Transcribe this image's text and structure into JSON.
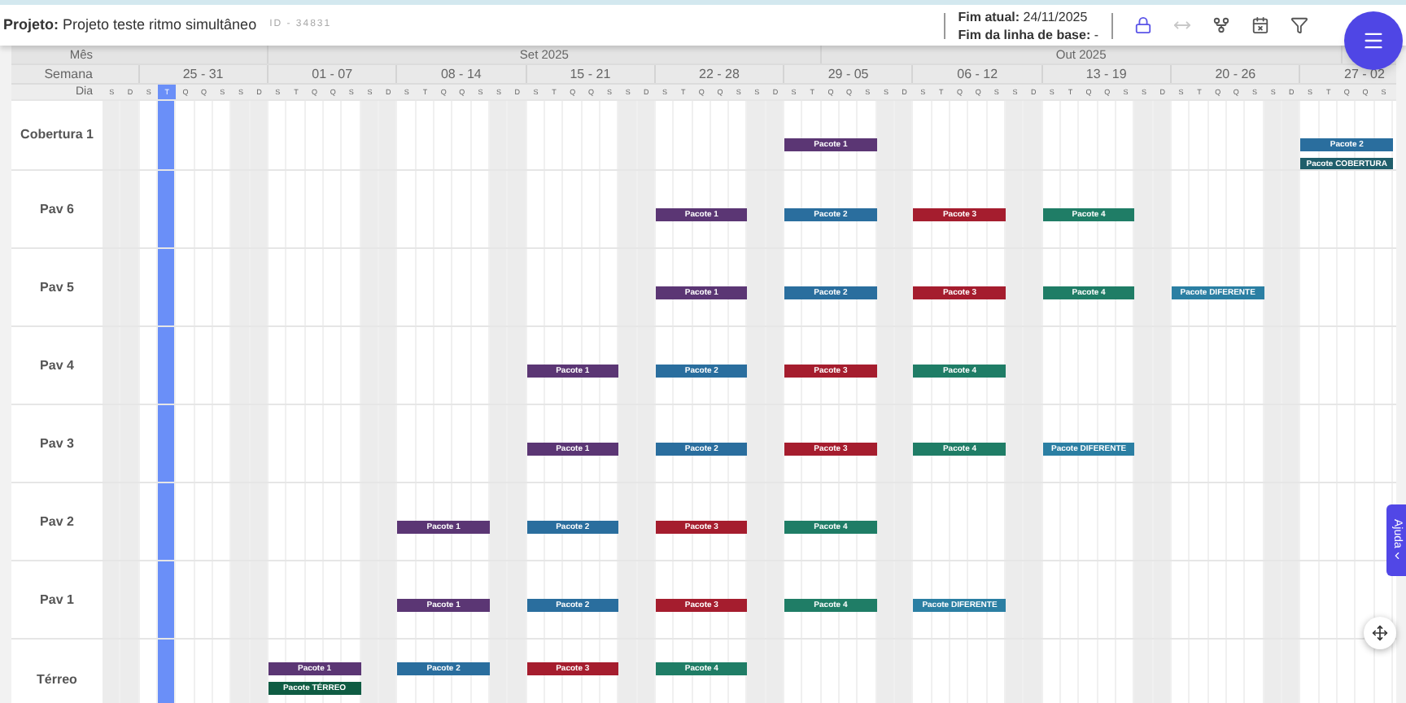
{
  "header": {
    "project": "**Projeto:** Projeto teste ritmo simultâneo",
    "project_id": "ID - 34831",
    "current_end": "**Fim atual:** 24/11/2025",
    "baseline_end": "**Fim da linha de base:** -",
    "toolbar": [
      {
        "kind": "lock",
        "disabled": false
      },
      {
        "kind": "expand",
        "disabled": true
      },
      {
        "kind": "fork",
        "disabled": false
      },
      {
        "kind": "calendar",
        "disabled": false
      },
      {
        "kind": "filter",
        "disabled": false
      }
    ]
  },
  "grid": {
    "month_label": "Mês",
    "week_label": "Semana",
    "day_label": "Dia",
    "months": [
      "Set 2025",
      "Out 2025"
    ],
    "weeks": [
      "25 - 31",
      "01 - 07",
      "08 - 14",
      "15 - 21",
      "22 - 28",
      "29 - 05",
      "06 - 12",
      "13 - 19",
      "20 - 26",
      "27 - 02"
    ],
    "days": [
      {
        "letter": "S",
        "today": false
      },
      {
        "letter": "D",
        "today": false
      },
      {
        "letter": "S",
        "today": false
      },
      {
        "letter": "T",
        "today": true
      },
      {
        "letter": "Q",
        "today": false
      },
      {
        "letter": "Q",
        "today": false
      },
      {
        "letter": "S",
        "today": false
      },
      {
        "letter": "S",
        "today": false
      },
      {
        "letter": "D",
        "today": false
      },
      {
        "letter": "S",
        "today": false
      },
      {
        "letter": "T",
        "today": false
      },
      {
        "letter": "Q",
        "today": false
      },
      {
        "letter": "Q",
        "today": false
      },
      {
        "letter": "S",
        "today": false
      },
      {
        "letter": "S",
        "today": false
      },
      {
        "letter": "D",
        "today": false
      },
      {
        "letter": "S",
        "today": false
      },
      {
        "letter": "T",
        "today": false
      },
      {
        "letter": "Q",
        "today": false
      },
      {
        "letter": "Q",
        "today": false
      },
      {
        "letter": "S",
        "today": false
      },
      {
        "letter": "S",
        "today": false
      },
      {
        "letter": "D",
        "today": false
      },
      {
        "letter": "S",
        "today": false
      },
      {
        "letter": "T",
        "today": false
      },
      {
        "letter": "Q",
        "today": false
      },
      {
        "letter": "Q",
        "today": false
      },
      {
        "letter": "S",
        "today": false
      },
      {
        "letter": "S",
        "today": false
      },
      {
        "letter": "D",
        "today": false
      },
      {
        "letter": "S",
        "today": false
      },
      {
        "letter": "T",
        "today": false
      },
      {
        "letter": "Q",
        "today": false
      },
      {
        "letter": "Q",
        "today": false
      },
      {
        "letter": "S",
        "today": false
      },
      {
        "letter": "S",
        "today": false
      },
      {
        "letter": "D",
        "today": false
      },
      {
        "letter": "S",
        "today": false
      },
      {
        "letter": "T",
        "today": false
      },
      {
        "letter": "Q",
        "today": false
      },
      {
        "letter": "Q",
        "today": false
      },
      {
        "letter": "S",
        "today": false
      },
      {
        "letter": "S",
        "today": false
      },
      {
        "letter": "D",
        "today": false
      },
      {
        "letter": "S",
        "today": false
      },
      {
        "letter": "T",
        "today": false
      },
      {
        "letter": "Q",
        "today": false
      },
      {
        "letter": "Q",
        "today": false
      },
      {
        "letter": "S",
        "today": false
      },
      {
        "letter": "S",
        "today": false
      },
      {
        "letter": "D",
        "today": false
      },
      {
        "letter": "S",
        "today": false
      },
      {
        "letter": "T",
        "today": false
      },
      {
        "letter": "Q",
        "today": false
      },
      {
        "letter": "Q",
        "today": false
      },
      {
        "letter": "S",
        "today": false
      },
      {
        "letter": "S",
        "today": false
      },
      {
        "letter": "D",
        "today": false
      },
      {
        "letter": "S",
        "today": false
      },
      {
        "letter": "T",
        "today": false
      },
      {
        "letter": "Q",
        "today": false
      },
      {
        "letter": "Q",
        "today": false
      },
      {
        "letter": "S",
        "today": false
      },
      {
        "letter": "S",
        "today": false
      },
      {
        "letter": "D",
        "today": false
      },
      {
        "letter": "S",
        "today": false
      },
      {
        "letter": "T",
        "today": false
      },
      {
        "letter": "Q",
        "today": false
      },
      {
        "letter": "Q",
        "today": false
      },
      {
        "letter": "S",
        "today": false
      }
    ],
    "rows": [
      {
        "label": "Cobertura 1",
        "weeks": {
          "week_5": [
            {
              "label": "Pacote 1",
              "color": "#5b3674"
            }
          ],
          "week_9": [
            {
              "label": "Pacote 2",
              "color": "#2a6e9e"
            },
            {
              "label": "Pacote COBERTURA",
              "color": "#1f5e6b"
            }
          ]
        }
      },
      {
        "label": "Pav 6",
        "weeks": {
          "week_4": [
            {
              "label": "Pacote 1",
              "color": "#5b3674"
            }
          ],
          "week_5": [
            {
              "label": "Pacote 2",
              "color": "#2a6e9e"
            }
          ],
          "week_6": [
            {
              "label": "Pacote 3",
              "color": "#a51d2e"
            }
          ],
          "week_7": [
            {
              "label": "Pacote 4",
              "color": "#1f7d66"
            }
          ]
        }
      },
      {
        "label": "Pav 5",
        "weeks": {
          "week_4": [
            {
              "label": "Pacote 1",
              "color": "#5b3674"
            }
          ],
          "week_5": [
            {
              "label": "Pacote 2",
              "color": "#2a6e9e"
            }
          ],
          "week_6": [
            {
              "label": "Pacote 3",
              "color": "#a51d2e"
            }
          ],
          "week_7": [
            {
              "label": "Pacote 4",
              "color": "#1f7d66"
            }
          ],
          "week_8": [
            {
              "label": "Pacote DIFERENTE",
              "color": "#2b7fa3"
            }
          ]
        }
      },
      {
        "label": "Pav 4",
        "weeks": {
          "week_3": [
            {
              "label": "Pacote 1",
              "color": "#5b3674"
            }
          ],
          "week_4": [
            {
              "label": "Pacote 2",
              "color": "#2a6e9e"
            }
          ],
          "week_5": [
            {
              "label": "Pacote 3",
              "color": "#a51d2e"
            }
          ],
          "week_6": [
            {
              "label": "Pacote 4",
              "color": "#1f7d66"
            }
          ]
        }
      },
      {
        "label": "Pav 3",
        "weeks": {
          "week_3": [
            {
              "label": "Pacote 1",
              "color": "#5b3674"
            }
          ],
          "week_4": [
            {
              "label": "Pacote 2",
              "color": "#2a6e9e"
            }
          ],
          "week_5": [
            {
              "label": "Pacote 3",
              "color": "#a51d2e"
            }
          ],
          "week_6": [
            {
              "label": "Pacote 4",
              "color": "#1f7d66"
            }
          ],
          "week_7": [
            {
              "label": "Pacote DIFERENTE",
              "color": "#2b7fa3"
            }
          ]
        }
      },
      {
        "label": "Pav 2",
        "weeks": {
          "week_2": [
            {
              "label": "Pacote 1",
              "color": "#5b3674"
            }
          ],
          "week_3": [
            {
              "label": "Pacote 2",
              "color": "#2a6e9e"
            }
          ],
          "week_4": [
            {
              "label": "Pacote 3",
              "color": "#a51d2e"
            }
          ],
          "week_5": [
            {
              "label": "Pacote 4",
              "color": "#1f7d66"
            }
          ]
        }
      },
      {
        "label": "Pav 1",
        "weeks": {
          "week_2": [
            {
              "label": "Pacote 1",
              "color": "#5b3674"
            }
          ],
          "week_3": [
            {
              "label": "Pacote 2",
              "color": "#2a6e9e"
            }
          ],
          "week_4": [
            {
              "label": "Pacote 3",
              "color": "#a51d2e"
            }
          ],
          "week_5": [
            {
              "label": "Pacote 4",
              "color": "#1f7d66"
            }
          ],
          "week_6": [
            {
              "label": "Pacote DIFERENTE",
              "color": "#2b7fa3"
            }
          ]
        }
      },
      {
        "label": "Térreo",
        "weeks": {
          "week_1": [
            {
              "label": "Pacote 1",
              "color": "#5b3674"
            },
            {
              "label": "Pacote TÉRREO",
              "color": "#0f5c43"
            }
          ],
          "week_2": [
            {
              "label": "Pacote 2",
              "color": "#2a6e9e"
            }
          ],
          "week_3": [
            {
              "label": "Pacote 3",
              "color": "#a51d2e"
            }
          ],
          "week_4": [
            {
              "label": "Pacote 4",
              "color": "#1f7d66"
            }
          ]
        }
      }
    ],
    "help_tab": "Ajuda"
  }
}
